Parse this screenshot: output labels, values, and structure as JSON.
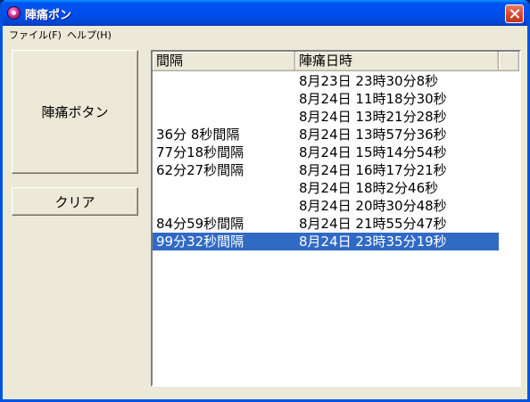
{
  "window": {
    "title": "陣痛ポン"
  },
  "menu": [
    {
      "label": "ファイル(F)"
    },
    {
      "label": "ヘルプ(H)"
    }
  ],
  "buttons": {
    "contraction": "陣痛ボタン",
    "clear": "クリア"
  },
  "table": {
    "columns": [
      "間隔",
      "陣痛日時"
    ],
    "rows": [
      {
        "interval": "",
        "datetime": "8月23日 23時30分8秒"
      },
      {
        "interval": "",
        "datetime": "8月24日 11時18分30秒"
      },
      {
        "interval": "",
        "datetime": "8月24日 13時21分28秒"
      },
      {
        "interval": "36分 8秒間隔",
        "datetime": "8月24日 13時57分36秒"
      },
      {
        "interval": "77分18秒間隔",
        "datetime": "8月24日 15時14分54秒"
      },
      {
        "interval": "62分27秒間隔",
        "datetime": "8月24日 16時17分21秒"
      },
      {
        "interval": "",
        "datetime": "8月24日 18時2分46秒"
      },
      {
        "interval": "",
        "datetime": "8月24日 20時30分48秒"
      },
      {
        "interval": "84分59秒間隔",
        "datetime": "8月24日 21時55分47秒"
      },
      {
        "interval": "99分32秒間隔",
        "datetime": "8月24日 23時35分19秒",
        "selected": true
      }
    ]
  },
  "colors": {
    "titlebar": "#0054e3",
    "selection": "#316ac5",
    "face": "#ece9d8"
  }
}
